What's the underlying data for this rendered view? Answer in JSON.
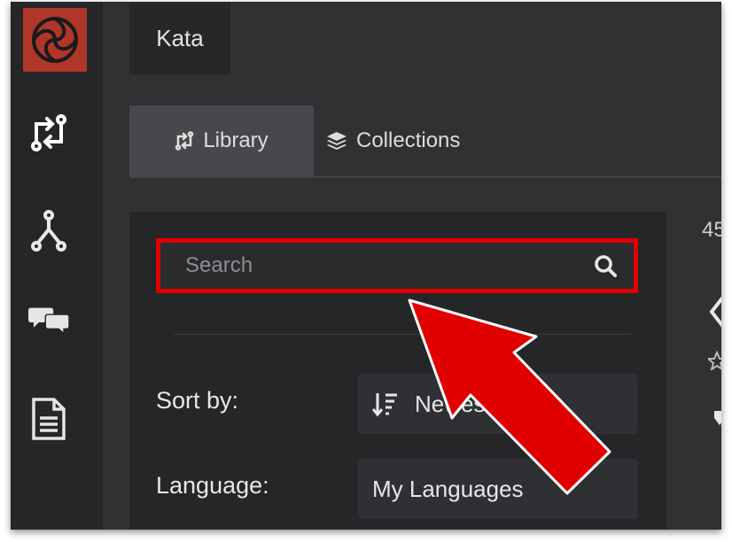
{
  "header": {
    "kata_tab": "Kata"
  },
  "tabs": [
    {
      "label": "Library",
      "icon": "swap-arrows-icon",
      "active": true
    },
    {
      "label": "Collections",
      "icon": "layers-icon",
      "active": false
    }
  ],
  "search": {
    "placeholder": "Search",
    "value": ""
  },
  "filters": {
    "sort_label": "Sort by:",
    "sort_value": "Newest",
    "language_label": "Language:",
    "language_value": "My Languages"
  },
  "results": {
    "count_text": "45"
  },
  "colors": {
    "highlight": "#e00000",
    "logo_bg": "#b1362a",
    "sidebar_bg": "#252627",
    "main_bg": "#303133"
  }
}
